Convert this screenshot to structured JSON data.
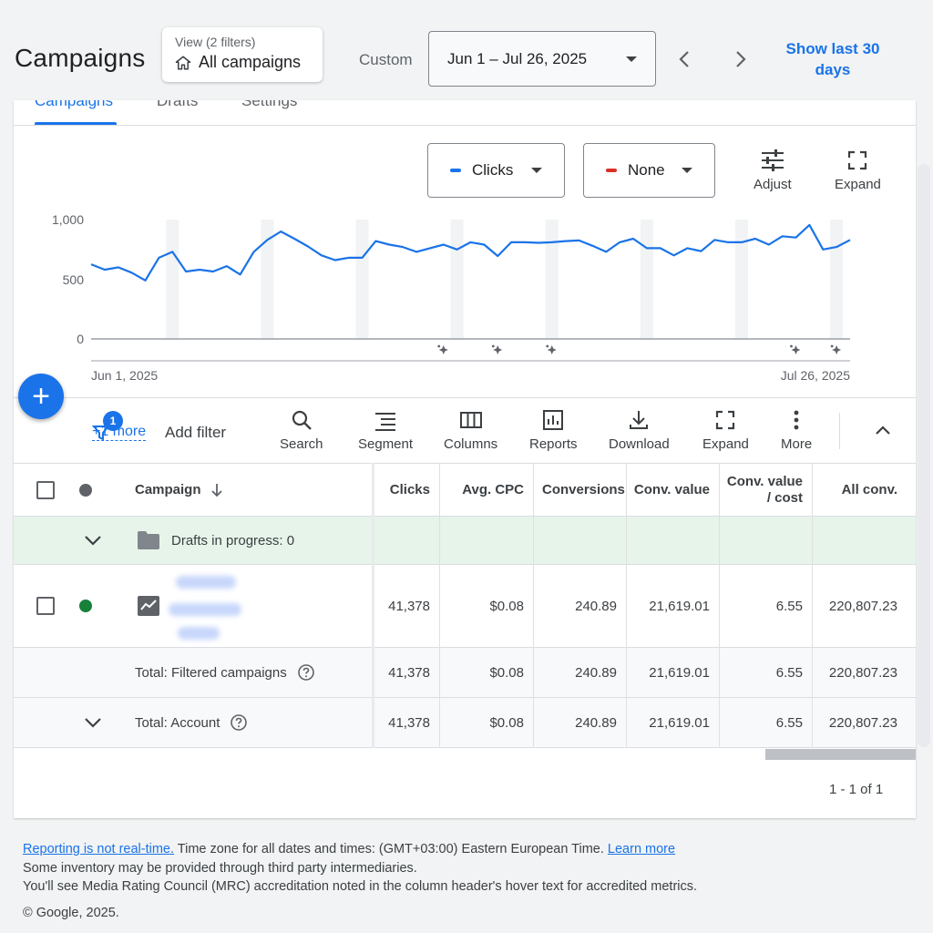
{
  "header": {
    "title": "Campaigns",
    "view_sub": "View (2 filters)",
    "view_main": "All campaigns",
    "custom_label": "Custom",
    "date_range": "Jun 1 – Jul 26, 2025",
    "show_last": "Show last 30 days"
  },
  "tabs": [
    {
      "label": "Campaigns",
      "active": true
    },
    {
      "label": "Drafts"
    },
    {
      "label": "Settings"
    }
  ],
  "chart_controls": {
    "metric1": "Clicks",
    "metric1_color": "#1a73e8",
    "metric2": "None",
    "metric2_color": "#d93025",
    "adjust": "Adjust",
    "expand": "Expand"
  },
  "chart_data": {
    "type": "line",
    "x_start_label": "Jun 1, 2025",
    "x_end_label": "Jul 26, 2025",
    "yticks": [
      "1,000",
      "500",
      "0"
    ],
    "ylim": [
      0,
      1000
    ],
    "series": [
      {
        "color": "#1a73e8",
        "values": [
          625,
          580,
          600,
          555,
          490,
          680,
          730,
          565,
          580,
          565,
          610,
          540,
          730,
          830,
          900,
          840,
          775,
          700,
          660,
          680,
          680,
          820,
          790,
          770,
          730,
          760,
          790,
          750,
          810,
          790,
          695,
          810,
          810,
          805,
          810,
          820,
          825,
          780,
          730,
          810,
          840,
          760,
          760,
          700,
          760,
          735,
          830,
          810,
          810,
          840,
          790,
          860,
          850,
          955,
          750,
          770,
          830
        ]
      }
    ],
    "annotation_icons": 5
  },
  "fab_label": "+",
  "toolbar": {
    "filter_badge": "1",
    "filter_more": "+1 more",
    "add_filter": "Add filter",
    "search": "Search",
    "segment": "Segment",
    "columns": "Columns",
    "reports": "Reports",
    "download": "Download",
    "expand": "Expand",
    "more": "More"
  },
  "table": {
    "headers": {
      "campaign": "Campaign",
      "clicks": "Clicks",
      "avg_cpc": "Avg. CPC",
      "conversions": "Conversions",
      "conv_value": "Conv. value",
      "conv_value_cost_1": "Conv. value",
      "conv_value_cost_2": "/ cost",
      "all_conv": "All conv."
    },
    "drafts_label": "Drafts in progress: 0",
    "campaign_row": {
      "status_color": "#188038",
      "clicks": "41,378",
      "avg_cpc": "$0.08",
      "conversions": "240.89",
      "conv_value": "21,619.01",
      "conv_value_cost": "6.55",
      "all_conv": "220,807.23"
    },
    "total_filtered": {
      "label": "Total: Filtered campaigns",
      "clicks": "41,378",
      "avg_cpc": "$0.08",
      "conversions": "240.89",
      "conv_value": "21,619.01",
      "conv_value_cost": "6.55",
      "all_conv": "220,807.23"
    },
    "total_account": {
      "label": "Total: Account",
      "clicks": "41,378",
      "avg_cpc": "$0.08",
      "conversions": "240.89",
      "conv_value": "21,619.01",
      "conv_value_cost": "6.55",
      "all_conv": "220,807.23"
    },
    "pager": "1 - 1 of 1"
  },
  "footer": {
    "reporting_link": "Reporting is not real-time.",
    "timezone": " Time zone for all dates and times: (GMT+03:00) Eastern European Time. ",
    "learn_more": "Learn more",
    "line2": "Some inventory may be provided through third party intermediaries.",
    "line3": "You'll see Media Rating Council (MRC) accreditation noted in the column header's hover text for accredited metrics.",
    "copyright": "© Google, 2025."
  }
}
